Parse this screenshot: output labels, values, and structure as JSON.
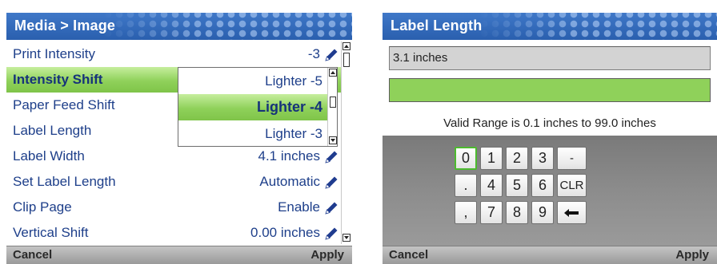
{
  "left_panel": {
    "title": "Media > Image",
    "menu_items": [
      {
        "label": "Print Intensity",
        "value": "-3",
        "has_edit": true
      },
      {
        "label": "Intensity Shift",
        "value": "",
        "has_edit": false,
        "selected": true
      },
      {
        "label": "Paper Feed Shift",
        "value": "",
        "has_edit": false
      },
      {
        "label": "Label Length",
        "value": "",
        "has_edit": false
      },
      {
        "label": "Label Width",
        "value": "4.1 inches",
        "has_edit": true
      },
      {
        "label": "Set Label Length",
        "value": "Automatic",
        "has_edit": true
      },
      {
        "label": "Clip Page",
        "value": "Enable",
        "has_edit": true
      },
      {
        "label": "Vertical Shift",
        "value": "0.00 inches",
        "has_edit": true
      }
    ],
    "dropdown": {
      "options": [
        "Lighter -5",
        "Lighter -4",
        "Lighter -3"
      ],
      "selected_index": 1
    },
    "softkeys": {
      "left": "Cancel",
      "right": "Apply"
    }
  },
  "right_panel": {
    "title": "Label Length",
    "value": "3.1 inches",
    "progress_fraction": 1.0,
    "range_text": "Valid Range is 0.1 inches to 99.0 inches",
    "keypad": {
      "row1": [
        "0",
        "1",
        "2",
        "3",
        "-"
      ],
      "row2": [
        ".",
        "4",
        "5",
        "6",
        "CLR"
      ],
      "row3": [
        ",",
        "7",
        "8",
        "9",
        "backspace"
      ],
      "focused_key": "0"
    },
    "softkeys": {
      "left": "Cancel",
      "right": "Apply"
    }
  },
  "colors": {
    "title_bar": "#2a5fae",
    "selection_green": "#8fd15a",
    "menu_text": "#1e3f8a",
    "softkey_bar": "#a8a8a8",
    "keypad_bg": "#8a8a8a",
    "focus_border": "#4cba2e"
  },
  "icons": {
    "edit": "pencil-icon",
    "backspace": "left-arrow-icon",
    "scroll_up": "triangle-up-icon",
    "scroll_down": "triangle-down-icon"
  }
}
